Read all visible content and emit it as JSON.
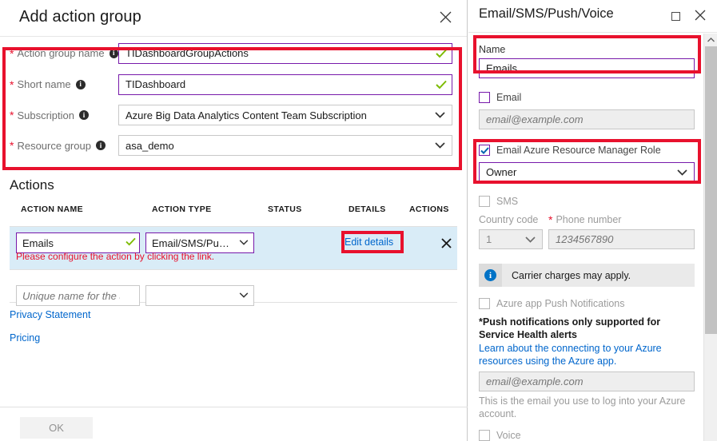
{
  "left_blade": {
    "title": "Add action group",
    "close_icon": "close-icon",
    "fields": [
      {
        "label": "Action group name",
        "required": true,
        "info_icon": "info-icon",
        "value": "TIDashboardGroupActions",
        "type": "text",
        "valid": true
      },
      {
        "label": "Short name",
        "required": true,
        "info_icon": "info-icon",
        "value": "TIDashboard",
        "type": "text",
        "valid": true
      },
      {
        "label": "Subscription",
        "required": true,
        "info_icon": "info-icon",
        "value": "Azure Big Data Analytics Content Team Subscription",
        "type": "select",
        "valid": false
      },
      {
        "label": "Resource group",
        "required": true,
        "info_icon": "info-icon",
        "value": "asa_demo",
        "type": "select",
        "valid": false
      }
    ],
    "actions": {
      "section_title": "Actions",
      "columns": [
        "ACTION NAME",
        "ACTION TYPE",
        "STATUS",
        "DETAILS",
        "ACTIONS"
      ],
      "rows": [
        {
          "name": "Emails",
          "type": "Email/SMS/Push/V...",
          "status": "",
          "details_link": "Edit details",
          "remove_icon": "close-icon",
          "error": "Please configure the action by clicking the link."
        }
      ],
      "new_row": {
        "name_placeholder": "Unique name for the act...",
        "type_value": ""
      }
    },
    "links": {
      "privacy": "Privacy Statement",
      "pricing": "Pricing"
    },
    "ok_label": "OK"
  },
  "right_blade": {
    "title": "Email/SMS/Push/Voice",
    "maximize_icon": "maximize-icon",
    "close_icon": "close-icon",
    "name_label": "Name",
    "name_value": "Emails",
    "email": {
      "checkbox_label": "Email",
      "checked": false,
      "placeholder": "email@example.com",
      "value": ""
    },
    "arm_role": {
      "checkbox_label": "Email Azure Resource Manager Role",
      "checked": true,
      "role_value": "Owner"
    },
    "sms": {
      "checkbox_label": "SMS",
      "checked": false,
      "country_code_label": "Country code",
      "country_code_value": "1",
      "phone_label": "Phone number",
      "phone_required": true,
      "phone_placeholder": "1234567890",
      "info_text": "Carrier charges may apply.",
      "info_icon": "info-icon"
    },
    "push": {
      "checkbox_label": "Azure app Push Notifications",
      "checked": false,
      "note_bold": "*Push notifications only supported for Service Health alerts",
      "note_link": "Learn about the connecting to your Azure resources using the Azure app.",
      "email_placeholder": "email@example.com",
      "help_text": "This is the email you use to log into your Azure account."
    },
    "voice": {
      "checkbox_label": "Voice",
      "checked": false
    },
    "scrollbar": {
      "up_icon": "chevron-up-icon"
    }
  },
  "highlights": {
    "color": "#e8112d",
    "count": 4
  }
}
